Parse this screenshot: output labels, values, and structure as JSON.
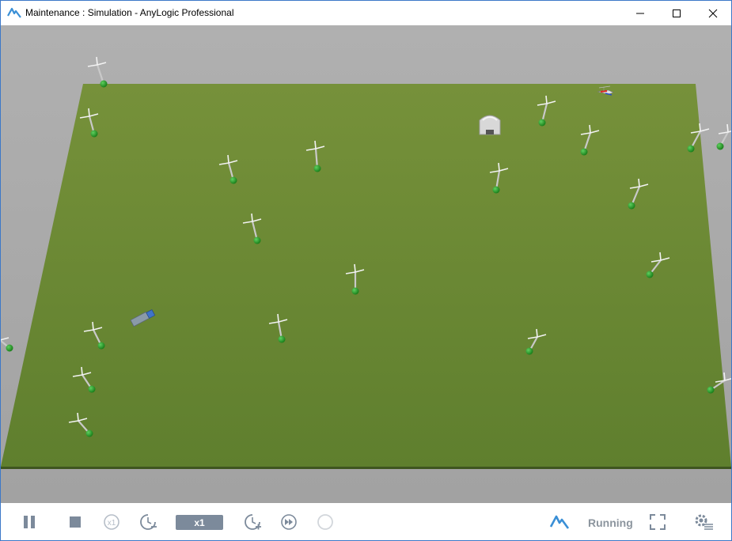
{
  "window": {
    "title": "Maintenance : Simulation - AnyLogic Professional"
  },
  "toolbar": {
    "speed_label": "x1",
    "status_text": "Running"
  },
  "icons": {
    "app": "anylogic-logo-icon",
    "minimize": "minimize-icon",
    "maximize": "maximize-icon",
    "close": "close-icon",
    "pause": "pause-icon",
    "stop": "stop-icon",
    "realtime": "realtime-x1-icon",
    "slowdown": "slow-down-icon",
    "speedup": "speed-up-icon",
    "fastforward": "fast-forward-icon",
    "step": "step-icon",
    "logo": "anylogic-logo-icon",
    "fullscreen": "fullscreen-icon",
    "settings": "settings-icon"
  },
  "colors": {
    "ground": "#6b8a34",
    "background": "#a8a8a8",
    "accent": "#3a8fd6",
    "speed_badge": "#7c8a9b"
  }
}
